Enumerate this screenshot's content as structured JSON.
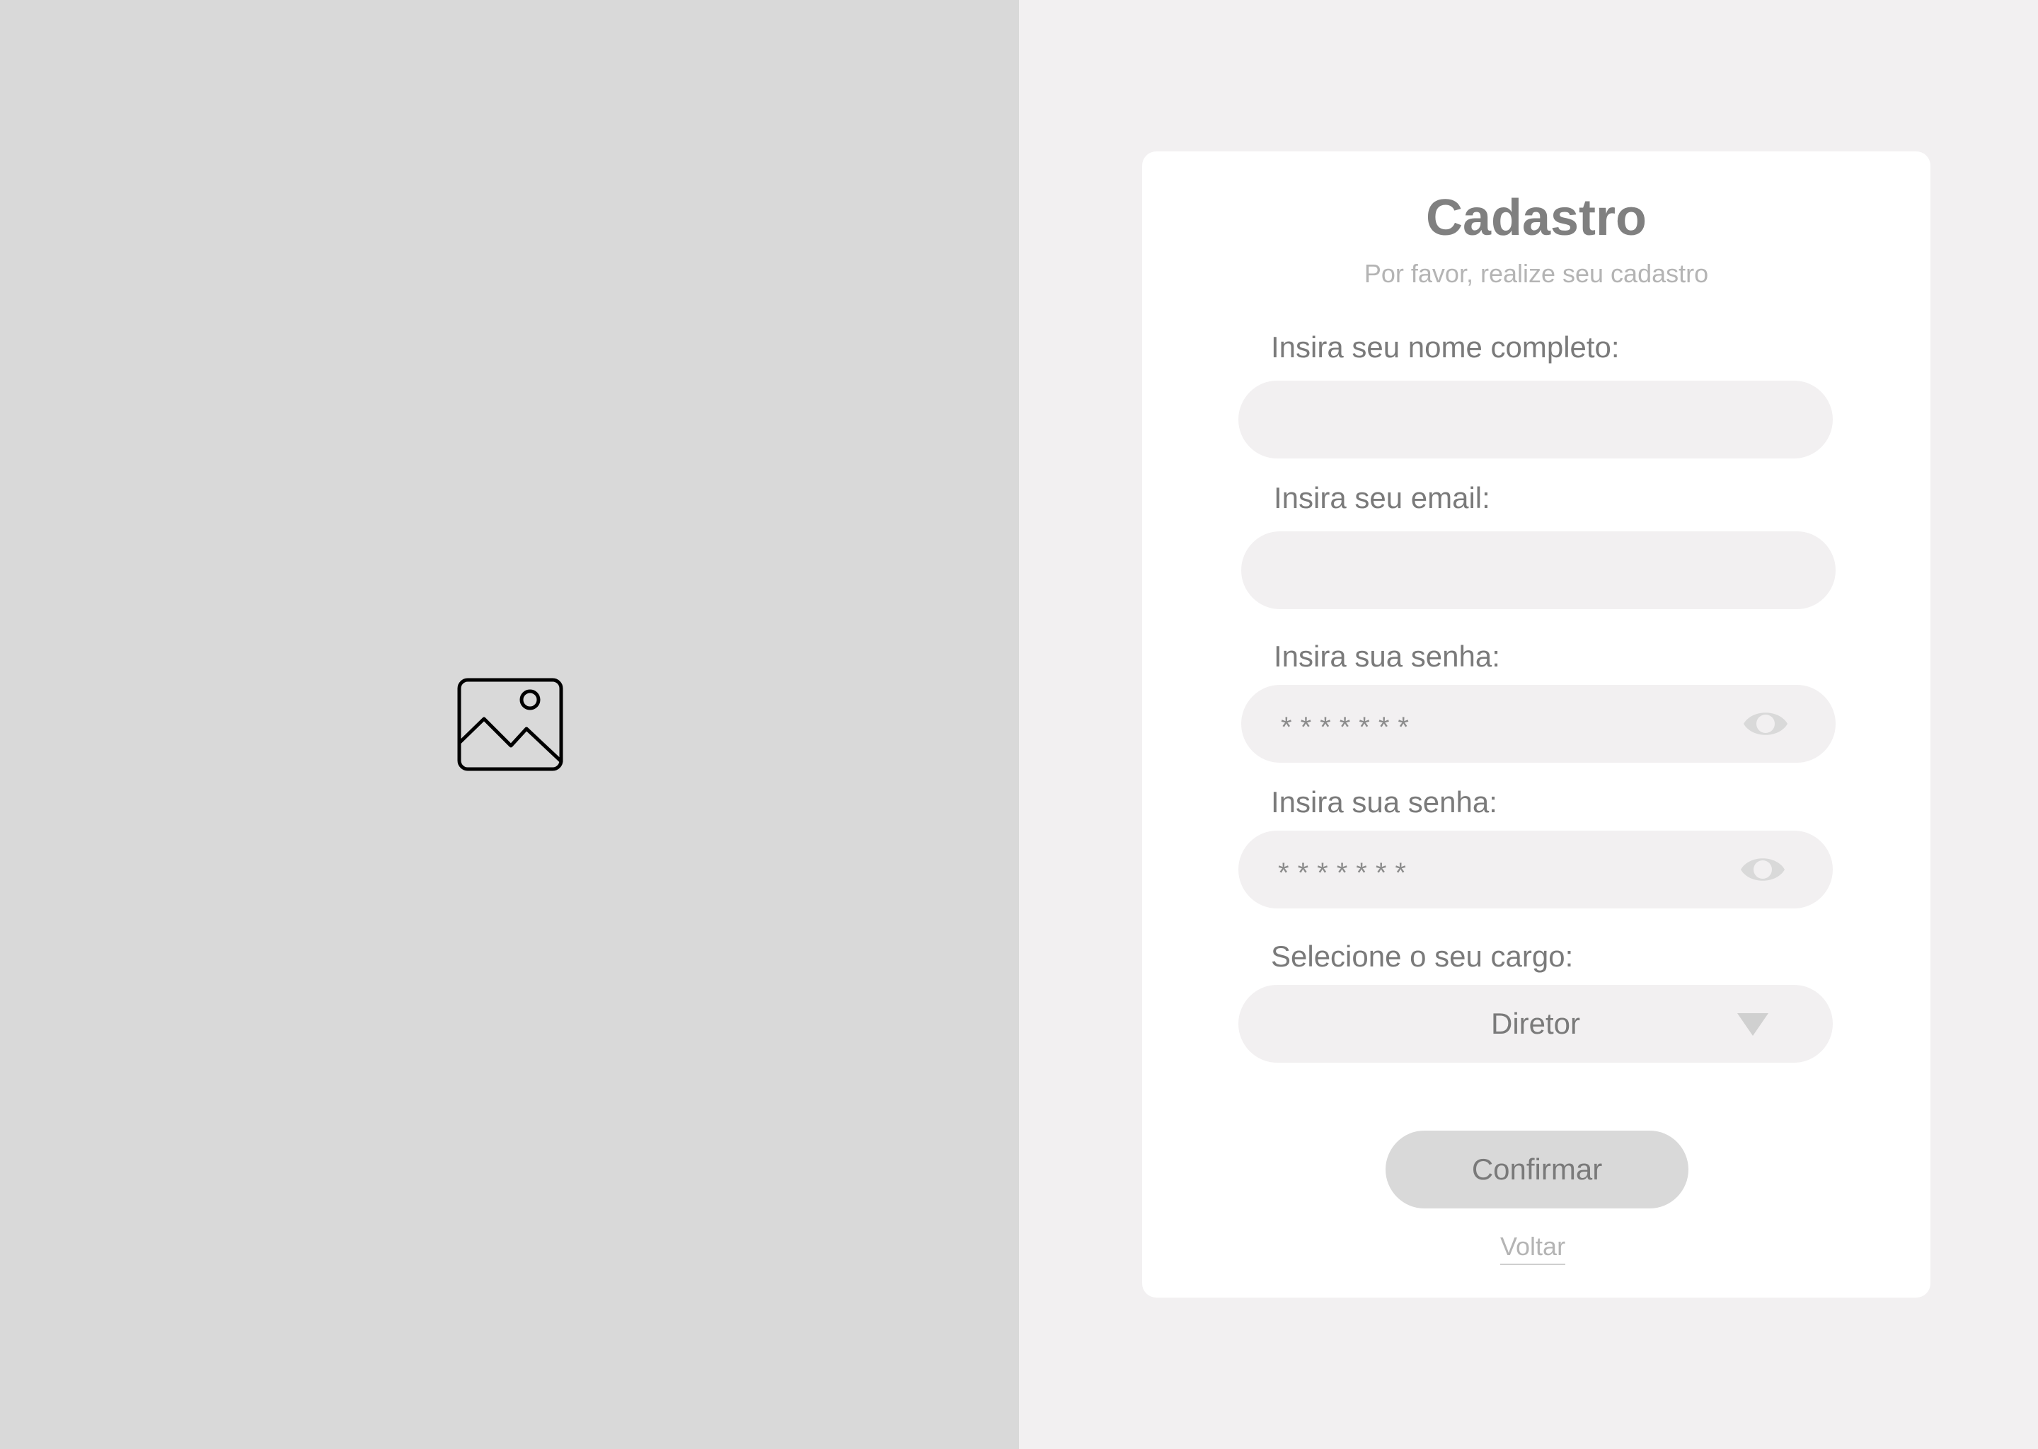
{
  "left_panel": {
    "icon": "image-icon"
  },
  "form": {
    "title": "Cadastro",
    "subtitle": "Por favor, realize seu cadastro",
    "fields": [
      {
        "label": "Insira seu nome completo:",
        "value": "",
        "placeholder": ""
      },
      {
        "label": "Insira seu email:",
        "value": "",
        "placeholder": ""
      },
      {
        "label": "Insira sua senha:",
        "value": "*******",
        "icon": "eye-icon"
      },
      {
        "label": "Insira sua senha:",
        "value": "*******",
        "icon": "eye-icon"
      }
    ],
    "role": {
      "label": "Selecione o seu cargo:",
      "selected": "Diretor",
      "icon": "chevron-down-icon"
    },
    "confirm_label": "Confirmar",
    "back_label": "Voltar"
  },
  "colors": {
    "left_panel_bg": "#d9d9d9",
    "page_bg": "#f2f0f1",
    "card_bg": "#ffffff",
    "field_bg": "#f2f0f1",
    "button_bg": "#d9d9d9",
    "text_gray": "#7a7a7a",
    "muted_gray": "#b4b4b4"
  }
}
